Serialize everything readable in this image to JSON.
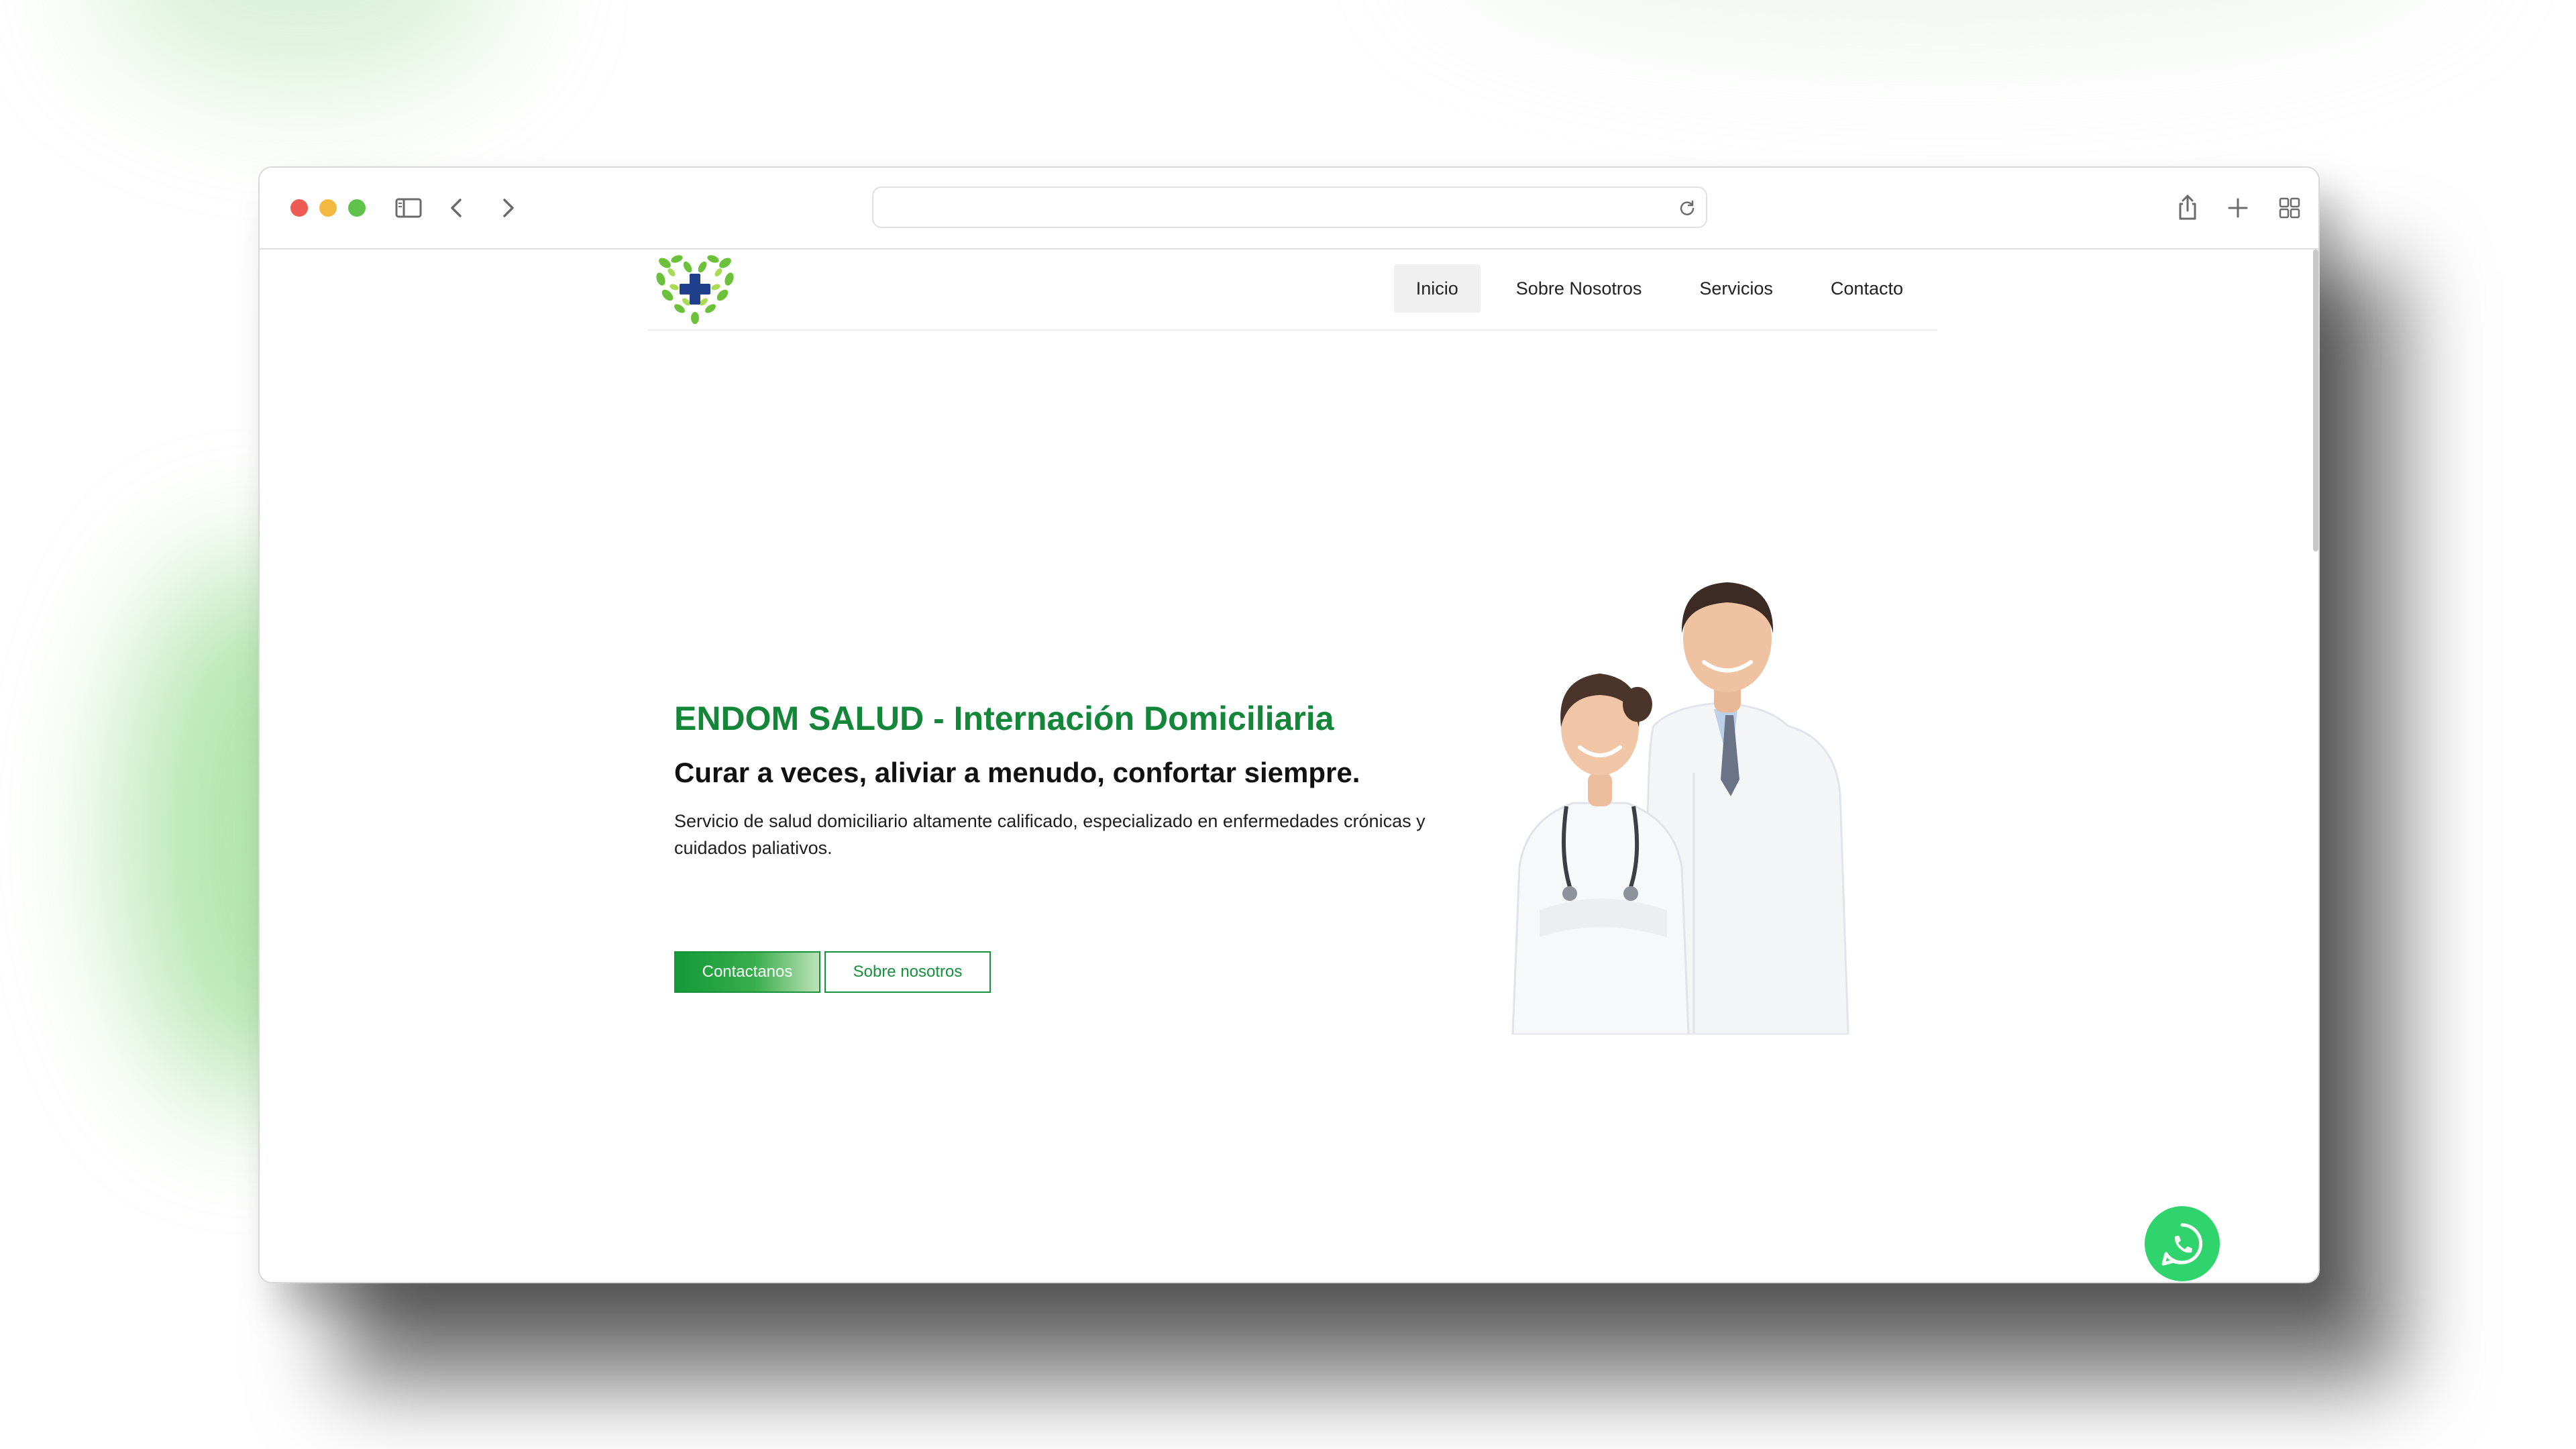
{
  "browser": {
    "address": ""
  },
  "header": {
    "logo": "heart-leaves-cross-logo",
    "nav": [
      {
        "label": "Inicio",
        "active": true
      },
      {
        "label": "Sobre Nosotros",
        "active": false
      },
      {
        "label": "Servicios",
        "active": false
      },
      {
        "label": "Contacto",
        "active": false
      }
    ]
  },
  "hero": {
    "title": "ENDOM SALUD - Internación Domiciliaria",
    "subtitle": "Curar a veces, aliviar a menudo, confortar siempre.",
    "description": "Servicio de salud domiciliario altamente calificado, especializado en enfermedades crónicas y cuidados paliativos.",
    "primary_button": "Contactanos",
    "secondary_button": "Sobre nosotros",
    "image": "doctors-photo"
  },
  "floating": {
    "icon": "whatsapp-icon"
  },
  "colors": {
    "brand_green": "#14863a",
    "button_green": "#18913d",
    "whatsapp_green": "#2fd46c",
    "logo_blue": "#1f3f8c"
  }
}
